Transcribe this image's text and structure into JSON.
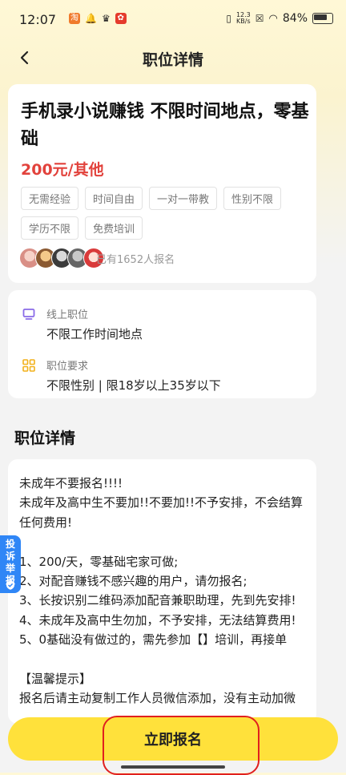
{
  "status_bar": {
    "time": "12:07",
    "net_speed_value": "12.3",
    "net_speed_unit": "KB/s",
    "battery": "84%"
  },
  "nav": {
    "title": "职位详情",
    "back_icon": "chevron-left-icon"
  },
  "job": {
    "title": "手机录小说赚钱 不限时间地点，零基础",
    "salary": "200元/其他",
    "tags": [
      "无需经验",
      "时间自由",
      "一对一带教",
      "性别不限",
      "学历不限",
      "免费培训"
    ],
    "applied_text": "已有1652人报名"
  },
  "info": {
    "type_label": "线上职位",
    "type_value": "不限工作时间地点",
    "req_label": "职位要求",
    "req_value": "不限性别 | 限18岁以上35岁以下"
  },
  "details": {
    "section_title": "职位详情",
    "lines": [
      "未成年不要报名!!!!",
      "未成年及高中生不要加!!不要加!!不予安排，不会结算任何费用!",
      "",
      "1、200/天，零基础宅家可做;",
      "2、对配音赚钱不感兴趣的用户，请勿报名;",
      "3、长按识别二维码添加配音兼职助理，先到先安排!",
      "4、未成年及高中生勿加，不予安排，无法结算费用!",
      "5、0基础没有做过的，需先参加【】培训，再接单",
      "",
      "【温馨提示】",
      "报名后请主动复制工作人员微信添加，没有主动加微"
    ]
  },
  "report": {
    "label": "投诉举报"
  },
  "apply": {
    "label": "立即报名"
  },
  "colors": {
    "accent": "#ffe13b",
    "salary": "#e2423c",
    "report": "#2f86f6",
    "highlight": "#e0201e"
  }
}
